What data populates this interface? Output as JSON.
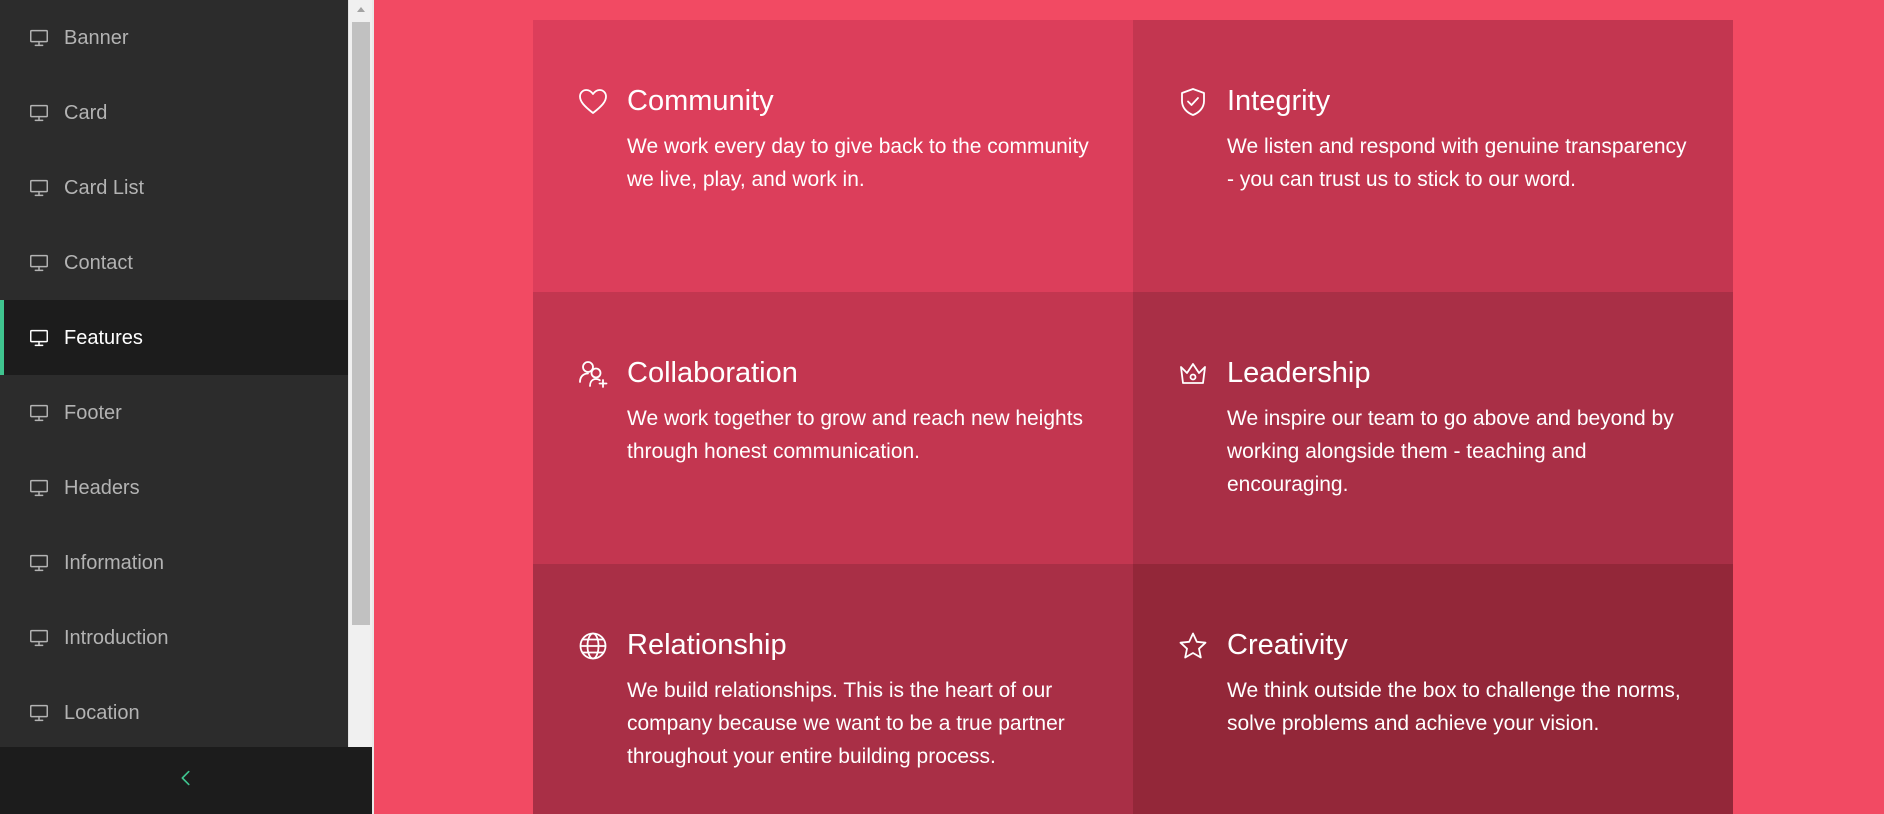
{
  "sidebar": {
    "items": [
      {
        "label": "Banner",
        "active": false
      },
      {
        "label": "Card",
        "active": false
      },
      {
        "label": "Card List",
        "active": false
      },
      {
        "label": "Contact",
        "active": false
      },
      {
        "label": "Features",
        "active": true
      },
      {
        "label": "Footer",
        "active": false
      },
      {
        "label": "Headers",
        "active": false
      },
      {
        "label": "Information",
        "active": false
      },
      {
        "label": "Introduction",
        "active": false
      },
      {
        "label": "Location",
        "active": false
      }
    ],
    "item_icon": "monitor-icon",
    "collapse_icon": "chevron-left-icon",
    "accent_color": "#3fc48f"
  },
  "features": {
    "background_color": "#f24a63",
    "cards": [
      {
        "icon": "heart-icon",
        "title": "Community",
        "text": "We work every day to give back to the community we live, play, and work in.",
        "color": "#dc3e5b"
      },
      {
        "icon": "shield-check-icon",
        "title": "Integrity",
        "text": "We listen and respond with genuine transparency - you can trust us to stick to our word.",
        "color": "#c33650"
      },
      {
        "icon": "users-plus-icon",
        "title": "Collaboration",
        "text": "We work together to grow and reach new heights through honest communication.",
        "color": "#c33650"
      },
      {
        "icon": "crown-icon",
        "title": "Leadership",
        "text": "We inspire our team to go above and beyond by working alongside them - teaching and encouraging.",
        "color": "#a92f46"
      },
      {
        "icon": "globe-icon",
        "title": "Relationship",
        "text": "We build relationships. This is the heart of our company because we want to be a true partner throughout your entire building process.",
        "color": "#a92f46"
      },
      {
        "icon": "star-icon",
        "title": "Creativity",
        "text": "We think outside the box to challenge the norms, solve problems and achieve your vision.",
        "color": "#932739"
      }
    ]
  }
}
